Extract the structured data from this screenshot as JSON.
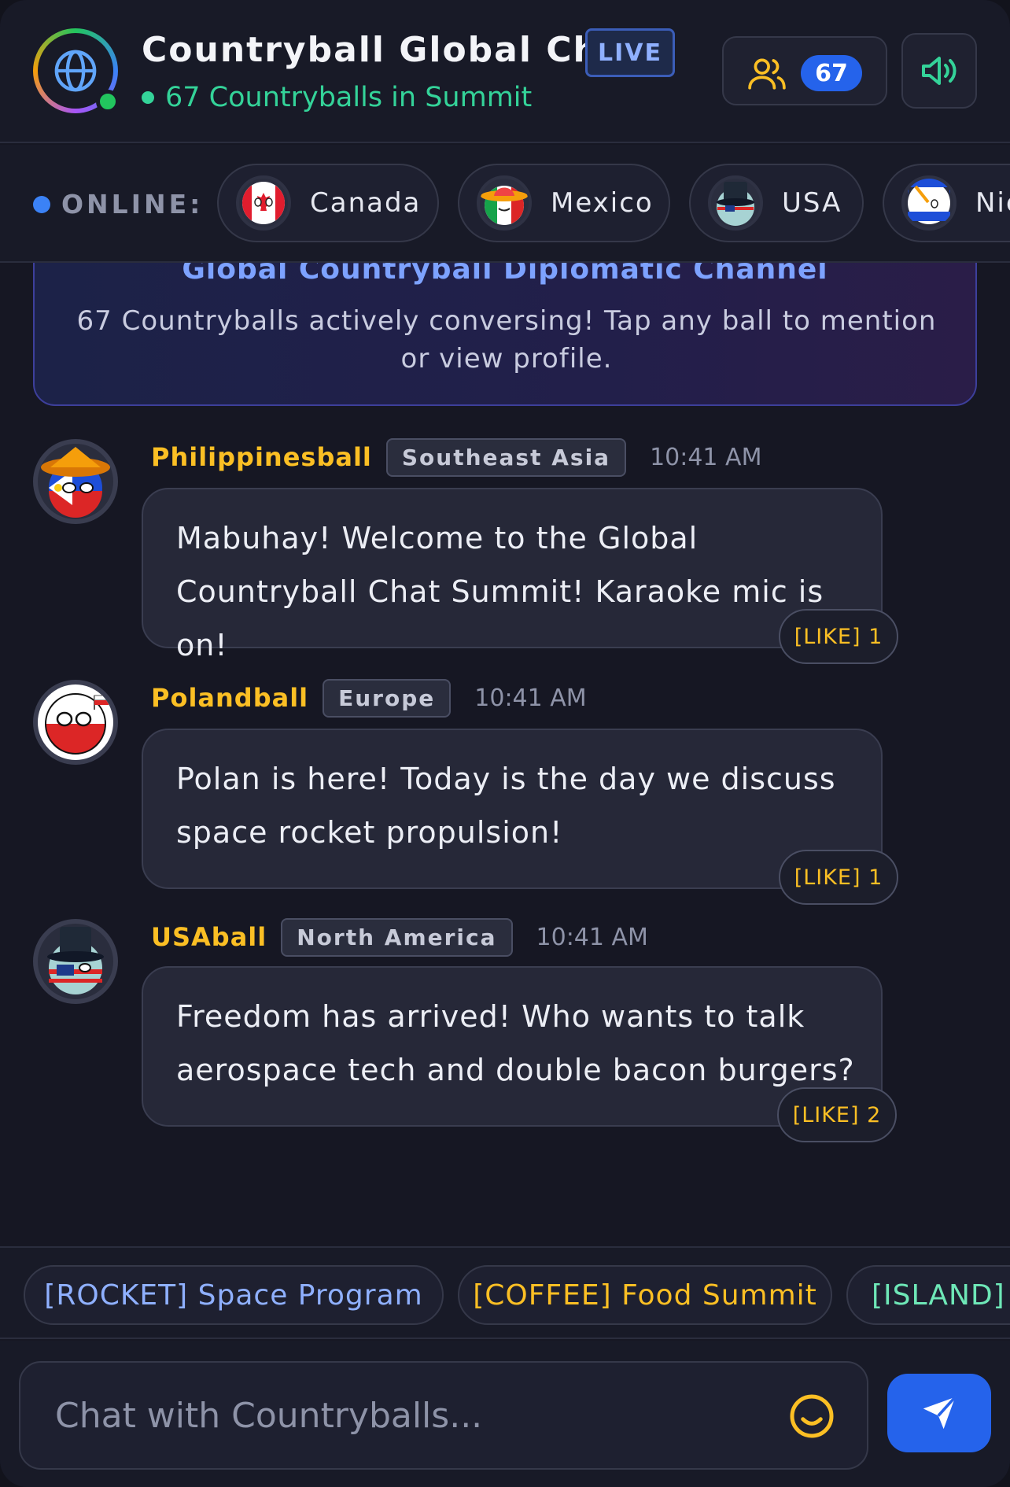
{
  "header": {
    "title": "Countryball Global Chat",
    "live_badge": "LIVE",
    "status_text": "67 Countryballs in Summit",
    "online_count": "67"
  },
  "online_bar": {
    "label": "ONLINE:",
    "users": [
      {
        "name": "Canada"
      },
      {
        "name": "Mexico"
      },
      {
        "name": "USA"
      },
      {
        "name": "Nic"
      }
    ]
  },
  "banner": {
    "title": "Global Countryball Diplomatic Channel",
    "subtitle": "67 Countryballs actively conversing! Tap any ball to mention or view profile."
  },
  "messages": [
    {
      "user": "Philippinesball",
      "region": "Southeast Asia",
      "time": "10:41 AM",
      "text": "Mabuhay! Welcome to the Global Countryball Chat Summit! Karaoke mic is on!",
      "likes": "[LIKE] 1"
    },
    {
      "user": "Polandball",
      "region": "Europe",
      "time": "10:41 AM",
      "text": "Polan is here! Today is the day we discuss space rocket propulsion!",
      "likes": "[LIKE] 1"
    },
    {
      "user": "USAball",
      "region": "North America",
      "time": "10:41 AM",
      "text": "Freedom has arrived! Who wants to talk aerospace tech and double bacon burgers?",
      "likes": "[LIKE] 2"
    }
  ],
  "topics": [
    {
      "label": "[ROCKET] Space Program",
      "color": "#8fb0ff"
    },
    {
      "label": "[COFFEE] Food Summit",
      "color": "#fbbf24"
    },
    {
      "label": "[ISLAND] C",
      "color": "#6ee7b7"
    }
  ],
  "composer": {
    "placeholder": "Chat with Countryballs..."
  },
  "colors": {
    "accent": "#2563eb",
    "online_green": "#34d399",
    "username_gold": "#fbbf24"
  }
}
